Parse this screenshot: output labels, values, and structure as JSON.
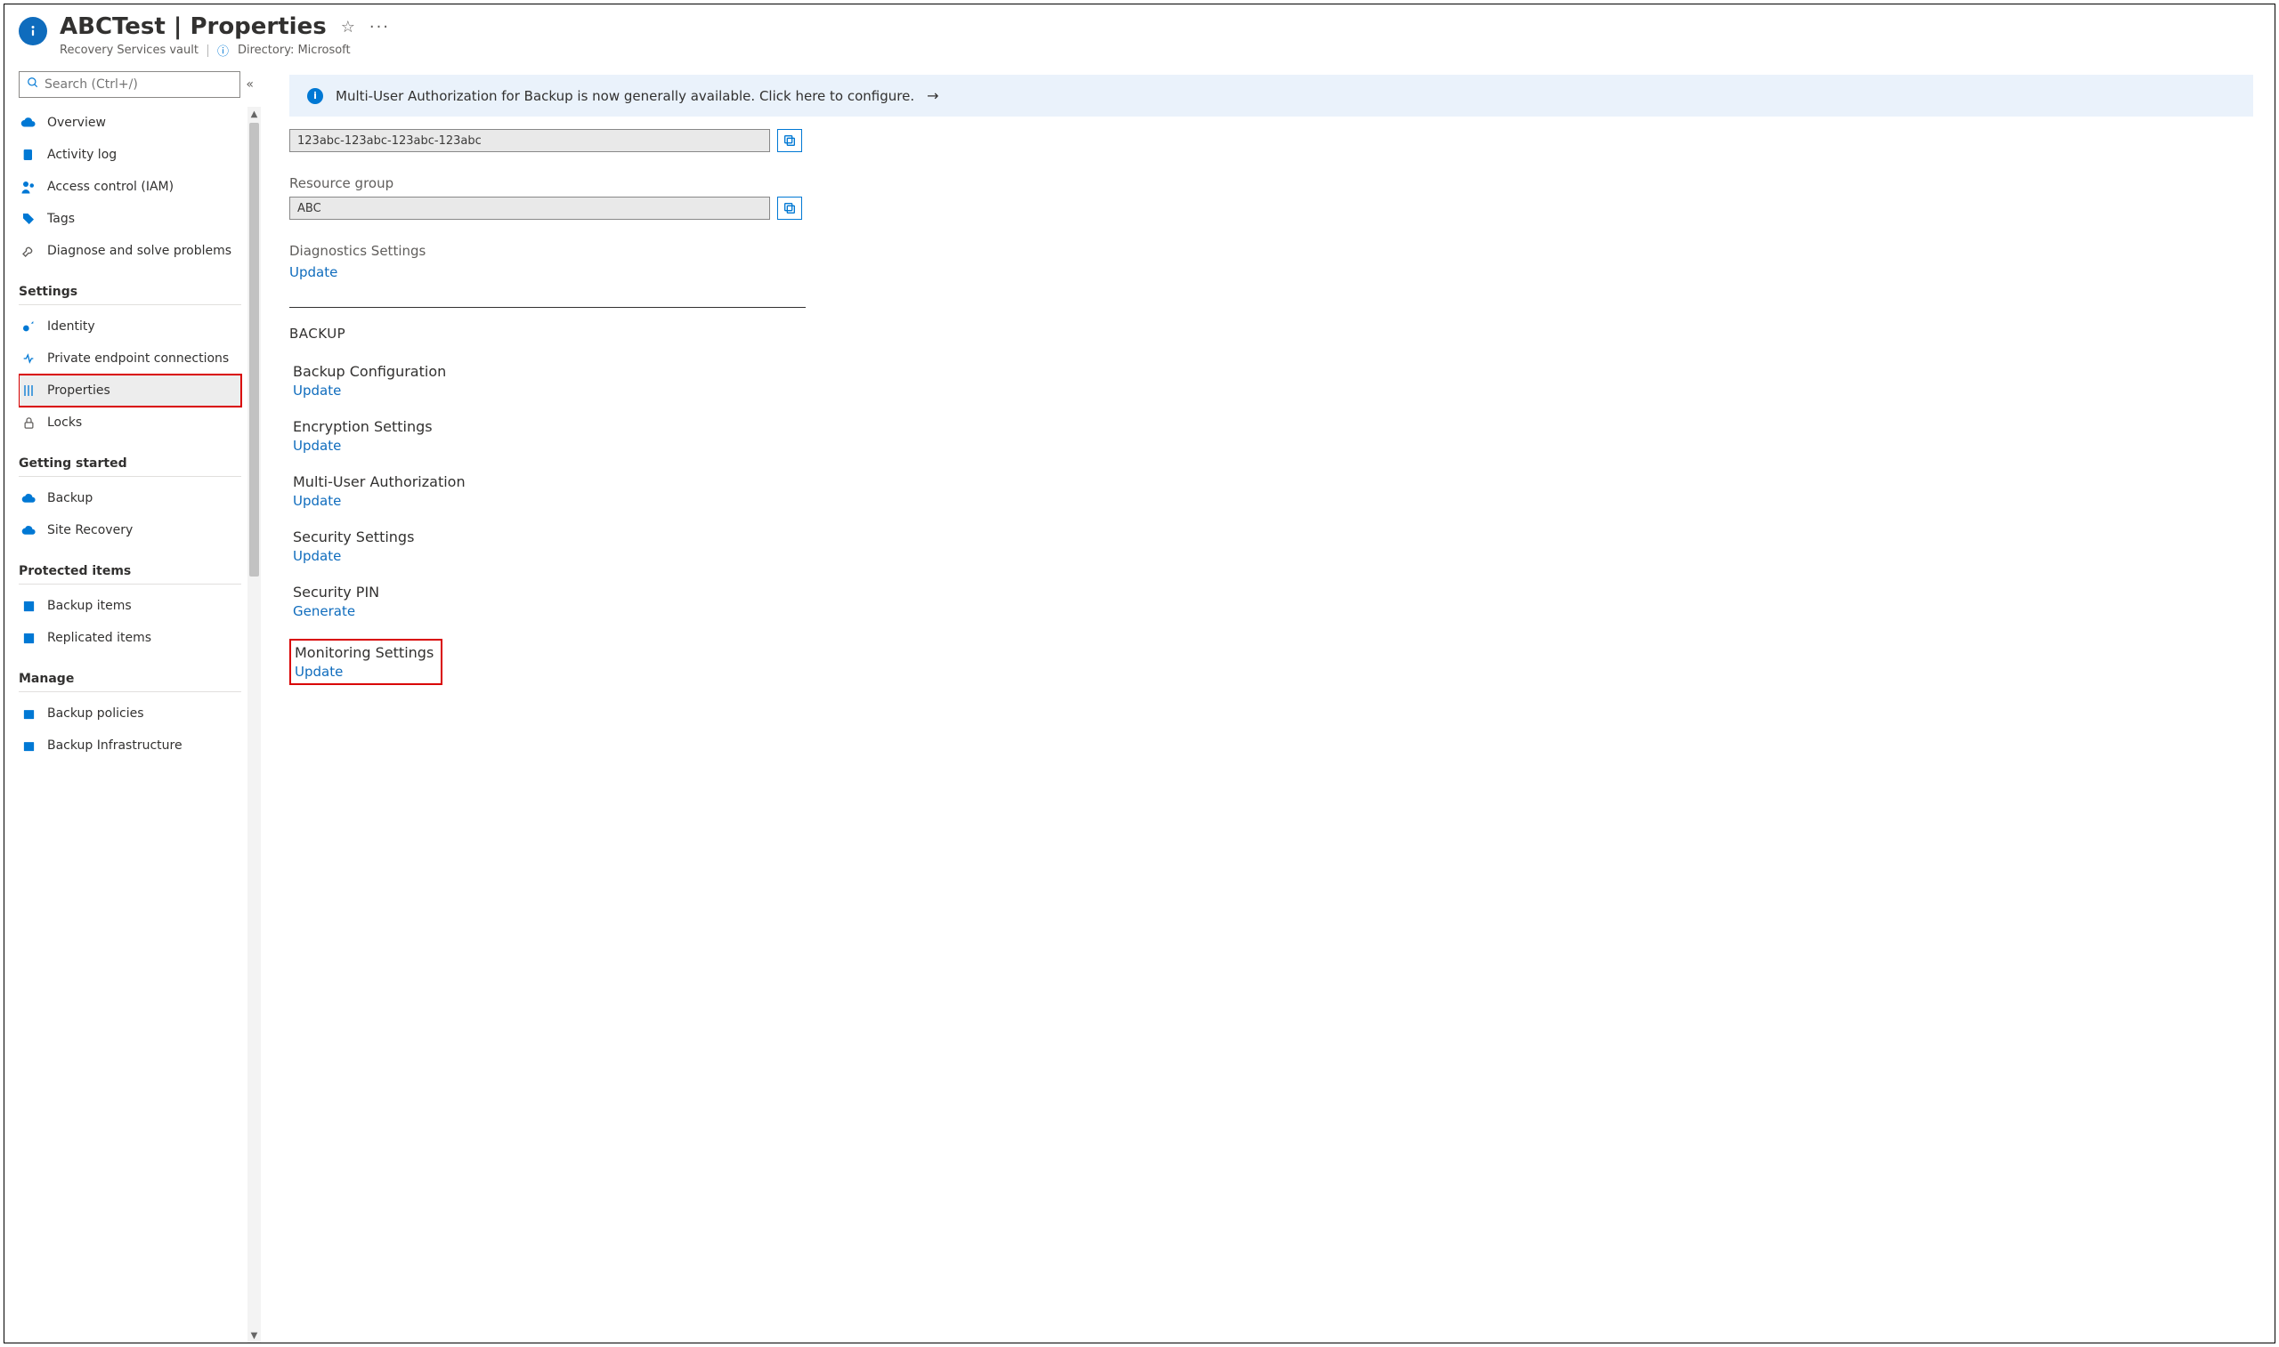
{
  "header": {
    "title": "ABCTest | Properties",
    "subtitle": "Recovery Services vault",
    "directory_label": "Directory: Microsoft"
  },
  "search": {
    "placeholder": "Search (Ctrl+/)"
  },
  "nav": {
    "top": [
      {
        "label": "Overview"
      },
      {
        "label": "Activity log"
      },
      {
        "label": "Access control (IAM)"
      },
      {
        "label": "Tags"
      },
      {
        "label": "Diagnose and solve problems"
      }
    ],
    "settings_label": "Settings",
    "settings": [
      {
        "label": "Identity"
      },
      {
        "label": "Private endpoint connections"
      },
      {
        "label": "Properties",
        "active": true
      },
      {
        "label": "Locks"
      }
    ],
    "getting_started_label": "Getting started",
    "getting_started": [
      {
        "label": "Backup"
      },
      {
        "label": "Site Recovery"
      }
    ],
    "protected_label": "Protected items",
    "protected": [
      {
        "label": "Backup items"
      },
      {
        "label": "Replicated items"
      }
    ],
    "manage_label": "Manage",
    "manage": [
      {
        "label": "Backup policies"
      },
      {
        "label": "Backup Infrastructure"
      }
    ]
  },
  "banner": {
    "text": "Multi-User Authorization for Backup is now generally available. Click here to configure."
  },
  "fields": {
    "id_value": "123abc-123abc-123abc-123abc",
    "resource_group_label": "Resource group",
    "resource_group_value": "ABC",
    "diag_label": "Diagnostics Settings",
    "diag_action": "Update"
  },
  "backup": {
    "section_label": "BACKUP",
    "items": [
      {
        "title": "Backup Configuration",
        "action": "Update"
      },
      {
        "title": "Encryption Settings",
        "action": "Update"
      },
      {
        "title": "Multi-User Authorization",
        "action": "Update"
      },
      {
        "title": "Security Settings",
        "action": "Update"
      },
      {
        "title": "Security PIN",
        "action": "Generate"
      },
      {
        "title": "Monitoring Settings",
        "action": "Update",
        "highlight": true
      }
    ]
  }
}
